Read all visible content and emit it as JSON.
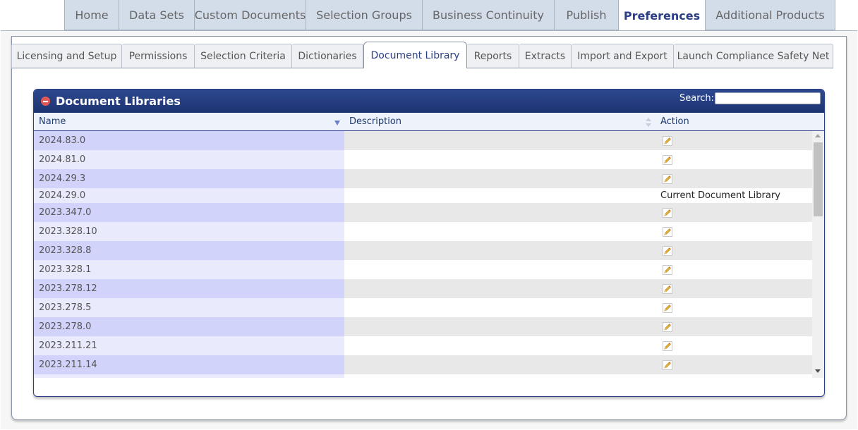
{
  "top_tabs": [
    {
      "label": "Home",
      "width": 78
    },
    {
      "label": "Data Sets",
      "width": 107
    },
    {
      "label": "Custom Documents",
      "width": 158
    },
    {
      "label": "Selection Groups",
      "width": 165
    },
    {
      "label": "Business Continuity",
      "width": 187
    },
    {
      "label": "Publish",
      "width": 91
    },
    {
      "label": "Preferences",
      "width": 123,
      "active": true
    },
    {
      "label": "Additional Products",
      "width": 184
    }
  ],
  "sub_tabs": [
    {
      "label": "Licensing and Setup",
      "width": 157
    },
    {
      "label": "Permissions",
      "width": 103
    },
    {
      "label": "Selection Criteria",
      "width": 138
    },
    {
      "label": "Dictionaries",
      "width": 101
    },
    {
      "label": "Document Library",
      "width": 147,
      "active": true
    },
    {
      "label": "Reports",
      "width": 74
    },
    {
      "label": "Extracts",
      "width": 74
    },
    {
      "label": "Import and Export",
      "width": 145
    },
    {
      "label": "Launch Compliance Safety Net",
      "width": 226
    }
  ],
  "panel": {
    "title": "Document Libraries",
    "search_label": "Search:",
    "search_value": ""
  },
  "columns": {
    "name": "Name",
    "description": "Description",
    "action": "Action"
  },
  "rows": [
    {
      "name": "2024.83.0",
      "description": "",
      "action": "edit"
    },
    {
      "name": "2024.81.0",
      "description": "",
      "action": "edit"
    },
    {
      "name": "2024.29.3",
      "description": "",
      "action": "edit"
    },
    {
      "name": "2024.29.0",
      "description": "",
      "action": "text",
      "action_text": "Current Document Library"
    },
    {
      "name": "2023.347.0",
      "description": "",
      "action": "edit"
    },
    {
      "name": "2023.328.10",
      "description": "",
      "action": "edit"
    },
    {
      "name": "2023.328.8",
      "description": "",
      "action": "edit"
    },
    {
      "name": "2023.328.1",
      "description": "",
      "action": "edit"
    },
    {
      "name": "2023.278.12",
      "description": "",
      "action": "edit"
    },
    {
      "name": "2023.278.5",
      "description": "",
      "action": "edit"
    },
    {
      "name": "2023.278.0",
      "description": "",
      "action": "edit"
    },
    {
      "name": "2023.211.21",
      "description": "",
      "action": "edit"
    },
    {
      "name": "2023.211.14",
      "description": "",
      "action": "edit"
    },
    {
      "name": "",
      "description": "",
      "action": "none"
    }
  ],
  "icons": {
    "edit": "pencil-edit-icon",
    "collapse": "collapse-icon",
    "sort": "sort-desc-icon"
  }
}
